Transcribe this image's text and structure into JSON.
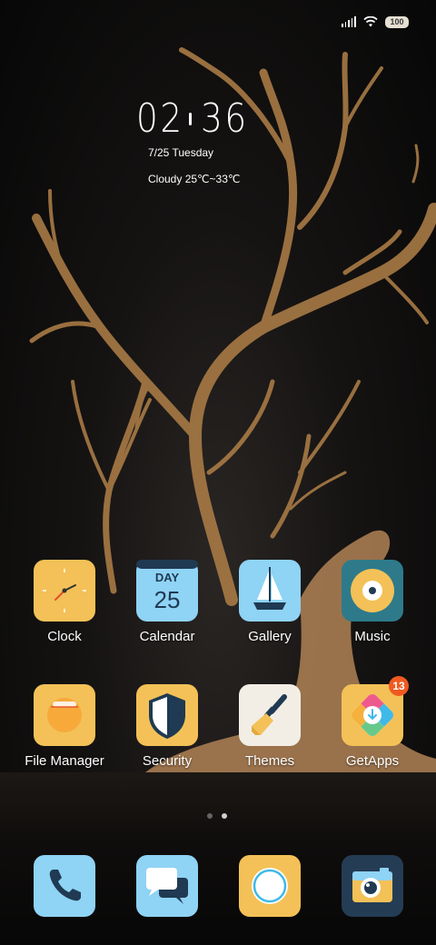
{
  "status_bar": {
    "battery": "100"
  },
  "clock_widget": {
    "hours": "02",
    "minutes": "36",
    "date": "7/25 Tuesday",
    "weather": "Cloudy 25℃~33℃"
  },
  "apps_row1": [
    {
      "label": "Clock",
      "icon": "clock-icon",
      "color": "#F3C157"
    },
    {
      "label": "Calendar",
      "icon": "calendar-icon",
      "color": "#8FD3F5",
      "icon_text_top": "DAY",
      "icon_text_bottom": "25"
    },
    {
      "label": "Gallery",
      "icon": "sailboat-icon",
      "color": "#8FD3F5"
    },
    {
      "label": "Music",
      "icon": "vinyl-icon",
      "color": "#2E7A8A"
    }
  ],
  "apps_row2": [
    {
      "label": "File Manager",
      "icon": "folder-icon",
      "color": "#F3C157"
    },
    {
      "label": "Security",
      "icon": "shield-icon",
      "color": "#F3C157"
    },
    {
      "label": "Themes",
      "icon": "paintbrush-icon",
      "color": "#F2EEE6"
    },
    {
      "label": "GetApps",
      "icon": "download-icon",
      "color": "#F3C157",
      "badge": "13"
    }
  ],
  "page_indicator": {
    "pages": 2,
    "active": 2
  },
  "dock": [
    {
      "icon": "phone-icon",
      "color": "#8FD3F5"
    },
    {
      "icon": "messages-icon",
      "color": "#8FD3F5"
    },
    {
      "icon": "browser-icon",
      "color": "#F3C157"
    },
    {
      "icon": "camera-icon",
      "color": "#253C55"
    }
  ]
}
